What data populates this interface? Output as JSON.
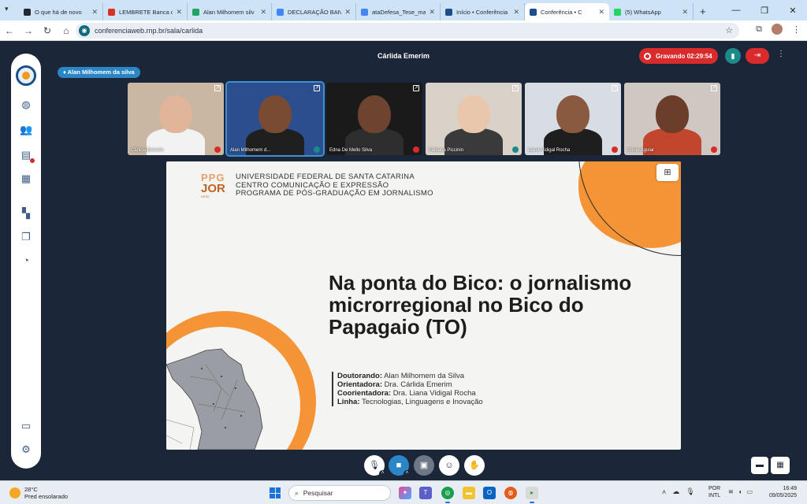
{
  "browser": {
    "tabs": [
      {
        "label": "O que há de novo",
        "icon": "github-icon",
        "color": "#24292f"
      },
      {
        "label": "LEMBRETE Banca de",
        "icon": "gmail-icon",
        "color": "#d93025"
      },
      {
        "label": "Alan Milhomem silv",
        "icon": "drive-icon",
        "color": "#1fa463"
      },
      {
        "label": "DECLARAÇÃO BANC",
        "icon": "docs-icon",
        "color": "#4285f4"
      },
      {
        "label": "ataDefesa_Tese_ma",
        "icon": "docs-icon",
        "color": "#4285f4"
      },
      {
        "label": "Início • Conferência",
        "icon": "conferencia-icon",
        "color": "#1b4f8a"
      },
      {
        "label": "Conferência • C",
        "icon": "conferencia-icon",
        "color": "#1b4f8a",
        "active": true
      },
      {
        "label": "(5) WhatsApp",
        "icon": "whatsapp-icon",
        "color": "#25d366"
      }
    ],
    "url": "conferenciaweb.rnp.br/sala/carlida"
  },
  "meeting": {
    "host_title": "Cárlida Emerim",
    "recording_label": "Gravando 02:29:54",
    "presenter_tag": "Alan Milhomem da silva"
  },
  "participants": [
    {
      "name": "Cárlida Emerim",
      "bg": "#c9b6a3",
      "skin": "#e0b59a",
      "body": "#f2f2f2",
      "muted": true
    },
    {
      "name": "Alan Milhomem d...",
      "bg": "#2b4f8e",
      "skin": "#7a4b33",
      "body": "#1f1f1f",
      "muted": false,
      "speaking": true
    },
    {
      "name": "Edna De Mello Silva",
      "bg": "#1a1a1a",
      "skin": "#6e4430",
      "body": "#2e2e2e",
      "muted": true
    },
    {
      "name": "Fabiana Piccinin",
      "bg": "#d9d2c8",
      "skin": "#e9c7ad",
      "body": "#3a3a3a",
      "muted": false
    },
    {
      "name": "Liana Vidigal Rocha",
      "bg": "#d7dde2",
      "skin": "#8a5a40",
      "body": "#1e1e1e",
      "muted": true
    },
    {
      "name": "Sonia Aguiar",
      "bg": "#cfc7c1",
      "skin": "#6b3e2b",
      "body": "#c2452e",
      "muted": true
    }
  ],
  "slide": {
    "logo_top": "PPG",
    "logo_main": "JOR",
    "logo_sub": "UFSC",
    "institution_lines": [
      "UNIVERSIDADE FEDERAL DE SANTA CATARINA",
      "CENTRO COMUNICAÇÃO E EXPRESSÃO",
      "PROGRAMA DE PÓS-GRADUAÇÃO EM JORNALISMO"
    ],
    "title": "Na ponta do Bico: o jornalismo microrregional no Bico do Papagaio (TO)",
    "credits": [
      {
        "label": "Doutorando:",
        "value": " Alan Milhomem da Silva"
      },
      {
        "label": "Orientadora:",
        "value": " Dra. Cárlida Emerim"
      },
      {
        "label": "Coorientadora:",
        "value": " Dra. Liana Vidigal Rocha"
      },
      {
        "label": "Linha:",
        "value": " Tecnologias, Linguagens e Inovação"
      }
    ],
    "accent_color": "#f59436"
  },
  "taskbar": {
    "weather_temp": "28°C",
    "weather_desc": "Pred ensolarado",
    "search_placeholder": "Pesquisar",
    "lang_top": "POR",
    "lang_bottom": "INTL",
    "time": "16:49",
    "date": "09/05/2025"
  }
}
